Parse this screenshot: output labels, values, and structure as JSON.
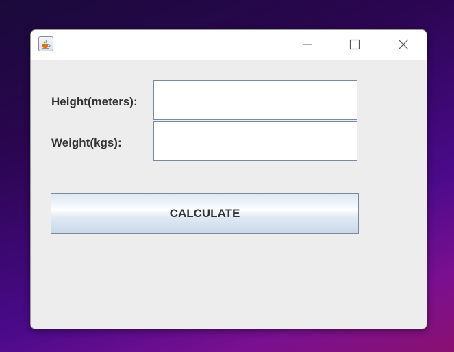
{
  "form": {
    "height_label": "Height(meters):",
    "height_value": "",
    "weight_label": "Weight(kgs):",
    "weight_value": "",
    "calculate_label": "CALCULATE"
  },
  "icons": {
    "app": "java-coffee-cup-icon",
    "minimize": "minimize-icon",
    "maximize": "maximize-icon",
    "close": "close-icon"
  },
  "colors": {
    "window_bg": "#ededed",
    "titlebar_bg": "#ffffff",
    "label_text": "#333333",
    "button_gradient_top": "#dde8f3",
    "button_gradient_bottom": "#c9d9ea"
  }
}
